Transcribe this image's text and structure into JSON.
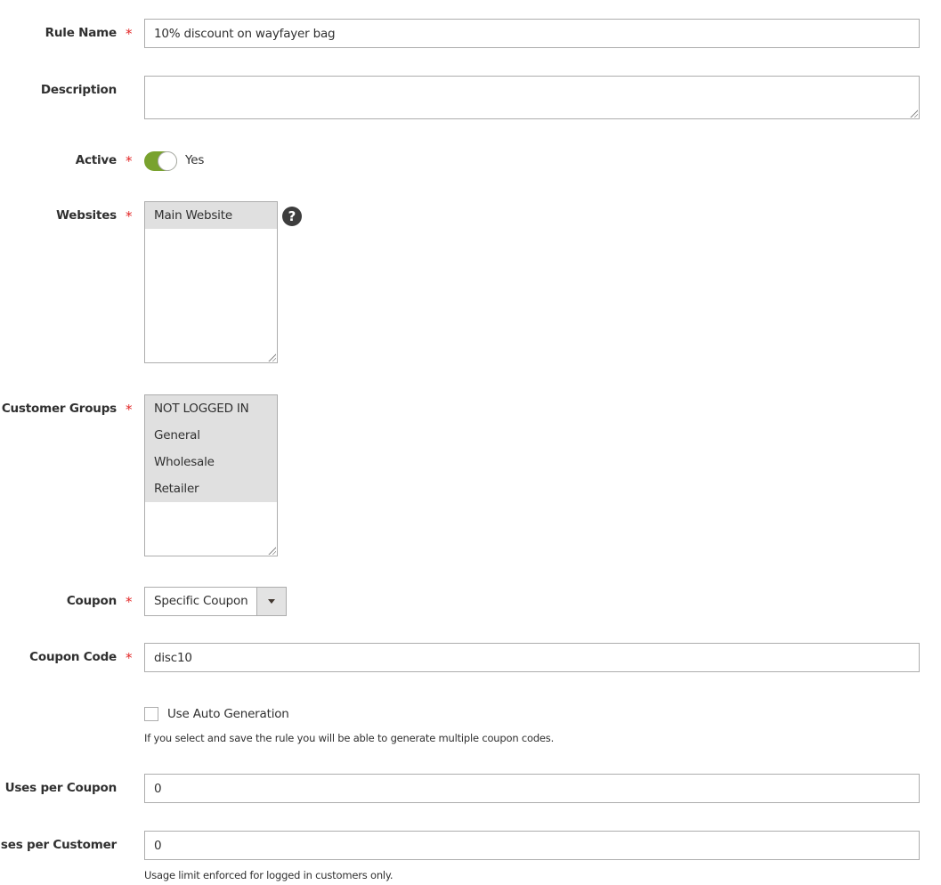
{
  "form": {
    "rule_name": {
      "label": "Rule Name",
      "required": "*",
      "value": "10% discount on wayfayer bag"
    },
    "description": {
      "label": "Description",
      "value": ""
    },
    "active": {
      "label": "Active",
      "required": "*",
      "state_label": "Yes",
      "on": true,
      "accent_color": "#79a22e"
    },
    "websites": {
      "label": "Websites",
      "required": "*",
      "options": [
        "Main Website"
      ],
      "help_icon": "?"
    },
    "customer_groups": {
      "label": "Customer Groups",
      "required": "*",
      "options": [
        "NOT LOGGED IN",
        "General",
        "Wholesale",
        "Retailer"
      ]
    },
    "coupon": {
      "label": "Coupon",
      "required": "*",
      "selected": "Specific Coupon"
    },
    "coupon_code": {
      "label": "Coupon Code",
      "required": "*",
      "value": "disc10"
    },
    "auto_generation": {
      "label": "Use Auto Generation",
      "checked": false,
      "note": "If you select and save the rule you will be able to generate multiple coupon codes."
    },
    "uses_per_coupon": {
      "label": "Uses per Coupon",
      "value": "0"
    },
    "uses_per_customer": {
      "label": "Uses per Customer",
      "value": "0",
      "note": "Usage limit enforced for logged in customers only."
    }
  }
}
